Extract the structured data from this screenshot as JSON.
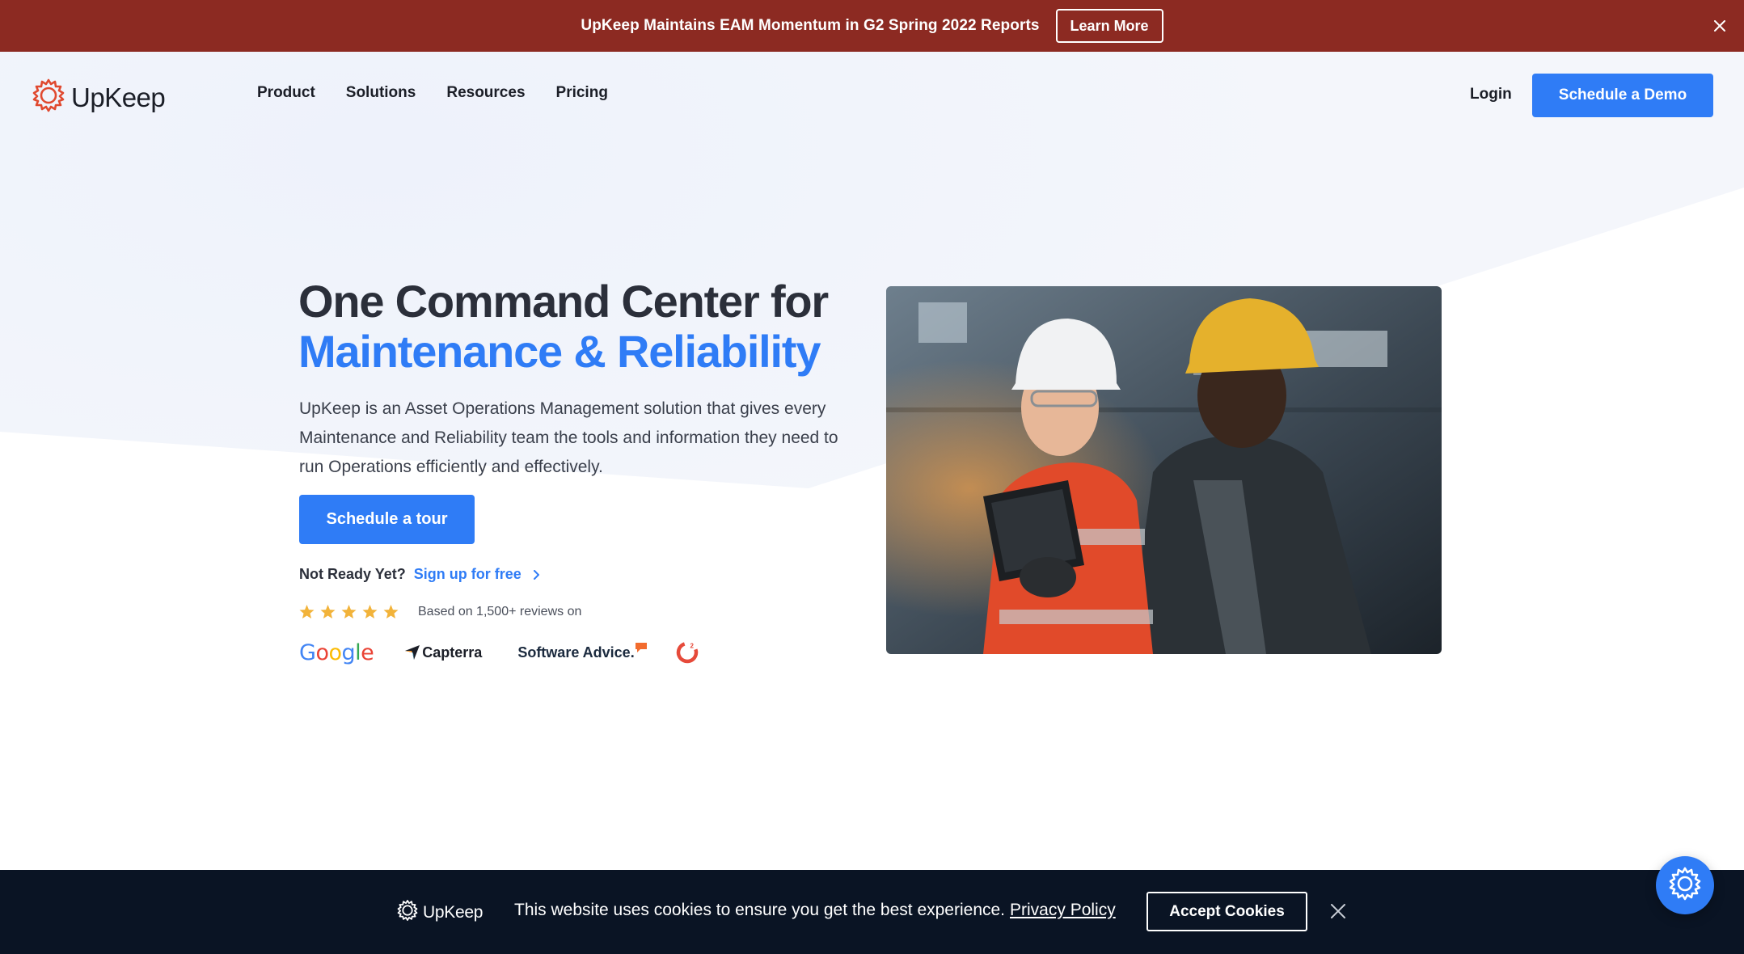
{
  "announcement": {
    "text": "UpKeep Maintains EAM Momentum in G2 Spring 2022 Reports",
    "button_label": "Learn More",
    "background_color": "#8c2a22"
  },
  "brand": {
    "name": "UpKeep",
    "accent_color": "#2f7cf6",
    "logo_icon": "gear-icon"
  },
  "nav": {
    "items": [
      {
        "label": "Product"
      },
      {
        "label": "Solutions"
      },
      {
        "label": "Resources"
      },
      {
        "label": "Pricing"
      }
    ],
    "login_label": "Login",
    "demo_label": "Schedule a Demo"
  },
  "hero": {
    "title_line1": "One Command Center for",
    "title_line2": "Maintenance & Reliability",
    "description": "UpKeep is an Asset Operations Management solution that gives every Maintenance and Reliability team the tools and information they need to run Operations efficiently and effectively.",
    "cta_label": "Schedule a tour",
    "not_ready_label": "Not Ready Yet?",
    "signup_label": "Sign up for free",
    "rating_stars": 5,
    "reviews_text": "Based on 1,500+ reviews on",
    "review_sites": [
      {
        "name": "Google"
      },
      {
        "name": "Capterra"
      },
      {
        "name": "Software Advice."
      },
      {
        "name": "G2"
      }
    ],
    "image": "workers-with-tablet-photo"
  },
  "cookie_banner": {
    "brand": "UpKeep",
    "text": "This website uses cookies to ensure you get the best experience.",
    "policy_label": "Privacy Policy",
    "accept_label": "Accept Cookies",
    "background_color": "#0a1424"
  },
  "floating_button": {
    "icon": "settings-gear-icon"
  }
}
